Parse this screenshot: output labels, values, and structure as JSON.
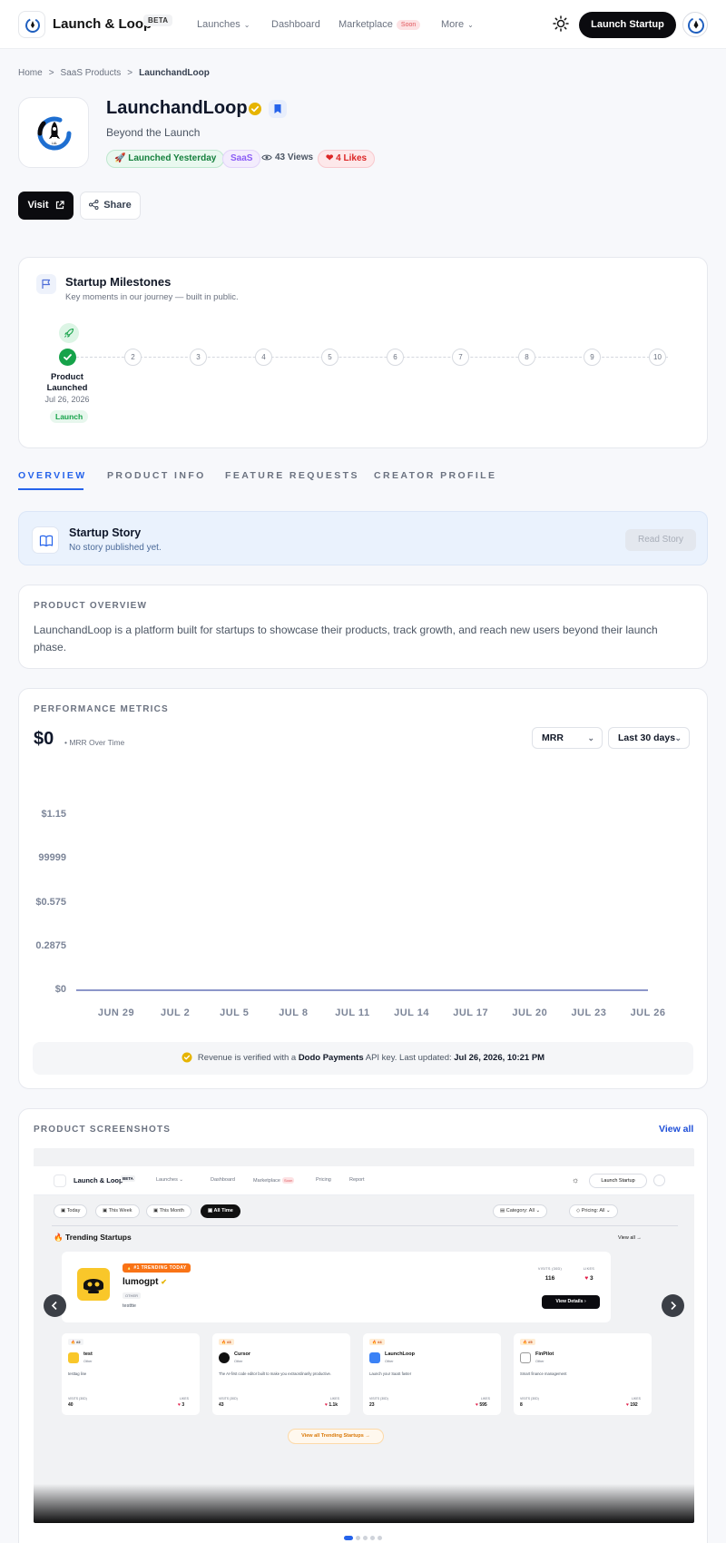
{
  "nav": {
    "brand": "Launch & Loop",
    "beta": "BETA",
    "items": [
      {
        "label": "Launches",
        "dropdown": true
      },
      {
        "label": "Dashboard"
      },
      {
        "label": "Marketplace",
        "badge": "Soon"
      },
      {
        "label": "More",
        "dropdown": true
      }
    ],
    "cta": "Launch Startup",
    "theme_icon": "sun-icon"
  },
  "breadcrumb": [
    "Home",
    "SaaS Products",
    "LaunchandLoop"
  ],
  "product": {
    "name": "LaunchandLoop",
    "tagline": "Beyond the Launch",
    "launch_chip": "Launched Yesterday",
    "category_chip": "SaaS",
    "views": "43 Views",
    "likes": "4 Likes",
    "visit_label": "Visit",
    "share_label": "Share"
  },
  "milestones": {
    "title": "Startup Milestones",
    "subtitle": "Key moments in our journey — built in public.",
    "first": {
      "label": "Product Launched",
      "date": "Jul 26, 2026",
      "tag": "Launch"
    },
    "steps": [
      "2",
      "3",
      "4",
      "5",
      "6",
      "7",
      "8",
      "9",
      "10"
    ]
  },
  "tabs": [
    "OVERVIEW",
    "PRODUCT INFO",
    "FEATURE REQUESTS",
    "CREATOR PROFILE"
  ],
  "active_tab": 0,
  "story": {
    "title": "Startup Story",
    "subtitle": "No story published yet.",
    "button": "Read Story"
  },
  "overview": {
    "heading": "PRODUCT OVERVIEW",
    "text": "LaunchandLoop is a platform built for startups to showcase their products, track growth, and reach new users beyond their launch phase."
  },
  "metrics": {
    "heading": "PERFORMANCE METRICS",
    "value": "$0",
    "value_caption": "• MRR Over Time",
    "metric_select": "MRR",
    "range_select": "Last 30 days",
    "verify_prefix": "Revenue is verified with a",
    "verify_provider": "Dodo Payments",
    "verify_mid": "API key. Last updated:",
    "verify_time": "Jul 26, 2026, 10:21 PM"
  },
  "chart_data": {
    "type": "line",
    "y_tick_labels": [
      "$1.15",
      "99999",
      "$0.575",
      "0.2875",
      "$0"
    ],
    "y_ticks": [
      1.15,
      0.8625,
      0.575,
      0.2875,
      0
    ],
    "ylim": [
      0,
      1.15
    ],
    "x_tick_labels": [
      "JUN 29",
      "JUL 2",
      "JUL 5",
      "JUL 8",
      "JUL 11",
      "JUL 14",
      "JUL 17",
      "JUL 20",
      "JUL 23",
      "JUL 26"
    ],
    "series": [
      {
        "values": [
          0,
          0,
          0,
          0,
          0,
          0,
          0,
          0,
          0,
          0
        ]
      }
    ],
    "line_color": "#8c96c9"
  },
  "screenshots": {
    "heading": "PRODUCT SCREENSHOTS",
    "view_all": "View all",
    "mock": {
      "brand": "Launch & Loop",
      "beta": "BETA",
      "nav": [
        "Launches ⌄",
        "Dashboard",
        "Marketplace",
        "Pricing",
        "Report"
      ],
      "soon": "Soon",
      "cta": "Launch Startup",
      "filters": [
        "Today",
        "This Week",
        "This Month",
        "All Time"
      ],
      "category_filter": "Category: All",
      "pricing_filter": "Pricing: All",
      "trending_title": "Trending Startups",
      "view_all": "View all →",
      "featured": {
        "tag": "🔥 #1 TRENDING TODAY",
        "name": "lumogpt",
        "category": "OTHER",
        "desc": "testtte",
        "visits_label": "VISITS (30D)",
        "visits": "116",
        "likes_label": "LIKES",
        "likes": "3",
        "button": "View Details"
      },
      "cards": [
        {
          "rank": "#2",
          "name": "test",
          "cat": "Other",
          "desc": "testtag line",
          "visits": "40",
          "likes": "3"
        },
        {
          "rank": "#3",
          "name": "Cursor",
          "cat": "Other",
          "desc": "The AI-first code editor built to make you extraordinarily productive.",
          "visits": "43",
          "likes": "1.1k"
        },
        {
          "rank": "#4",
          "name": "LaunchLoop",
          "cat": "Other",
          "desc": "Launch your SaaS faster",
          "visits": "23",
          "likes": "595"
        },
        {
          "rank": "#5",
          "name": "FinPilot",
          "cat": "Other",
          "desc": "Smart finance management",
          "visits": "8",
          "likes": "192"
        }
      ],
      "visits_label": "VISITS (30D)",
      "likes_label": "LIKES",
      "all_button": "View all Trending Startups →"
    },
    "page_count": 5,
    "active_page": 0
  }
}
